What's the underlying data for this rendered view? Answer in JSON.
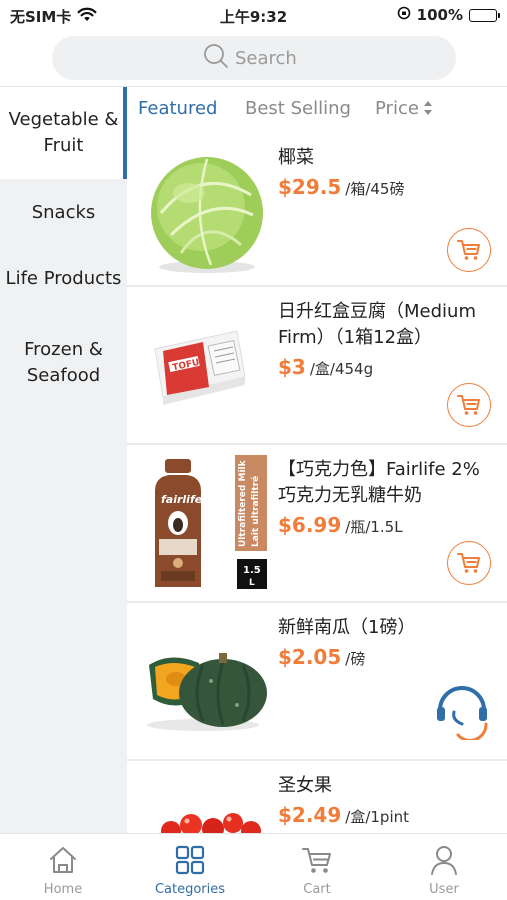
{
  "status_bar": {
    "carrier": "无SIM卡",
    "time": "上午9:32",
    "battery": "100%"
  },
  "search": {
    "placeholder": "Search"
  },
  "sidebar": {
    "items": [
      {
        "label": "Vegetable & Fruit"
      },
      {
        "label": "Snacks"
      },
      {
        "label": "Life Products"
      },
      {
        "label": "Frozen & Seafood"
      }
    ]
  },
  "sort_tabs": {
    "featured": "Featured",
    "best_selling": "Best Selling",
    "price": "Price"
  },
  "products": [
    {
      "name": "椰菜",
      "price": "$29.5",
      "unit": "/箱/45磅"
    },
    {
      "name": "日升红盒豆腐（Medium Firm）（1箱12盒）",
      "price": "$3",
      "unit": "/盒/454g"
    },
    {
      "name": "【巧克力色】Fairlife 2% 巧克力无乳糖牛奶",
      "price": "$6.99",
      "unit": "/瓶/1.5L"
    },
    {
      "name": "新鲜南瓜（1磅）",
      "price": "$2.05",
      "unit": "/磅"
    },
    {
      "name": "圣女果",
      "price": "$2.49",
      "unit": "/盒/1pint"
    }
  ],
  "tab_bar": {
    "home": "Home",
    "categories": "Categories",
    "cart": "Cart",
    "user": "User"
  },
  "colors": {
    "accent": "#2f6ea8",
    "price": "#f07d3a",
    "sidebar_bg": "#eff1f3"
  }
}
